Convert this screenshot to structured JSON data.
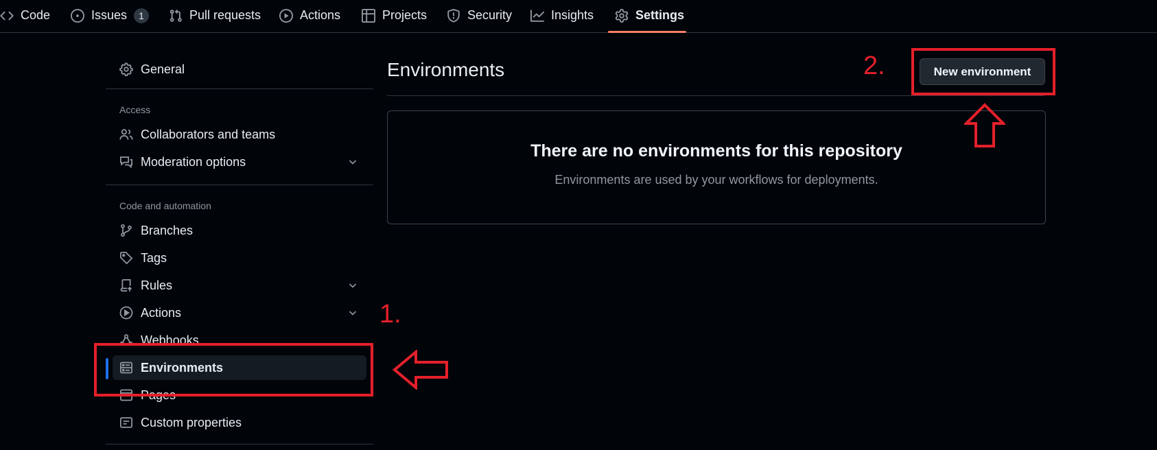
{
  "topnav": {
    "tabs": [
      {
        "label": "Code",
        "icon": "code-icon"
      },
      {
        "label": "Issues",
        "icon": "issue-opened-icon",
        "count": "1"
      },
      {
        "label": "Pull requests",
        "icon": "git-pull-request-icon"
      },
      {
        "label": "Actions",
        "icon": "play-icon"
      },
      {
        "label": "Projects",
        "icon": "table-icon"
      },
      {
        "label": "Security",
        "icon": "shield-icon"
      },
      {
        "label": "Insights",
        "icon": "graph-icon"
      },
      {
        "label": "Settings",
        "icon": "gear-icon",
        "active": true
      }
    ]
  },
  "sidebar": {
    "general": "General",
    "sections": [
      {
        "label": "Access",
        "items": [
          "Collaborators and teams",
          "Moderation options"
        ]
      },
      {
        "label": "Code and automation",
        "items": [
          "Branches",
          "Tags",
          "Rules",
          "Actions",
          "Webhooks",
          "Environments",
          "Pages",
          "Custom properties"
        ]
      }
    ],
    "active_item": "Environments"
  },
  "main": {
    "title": "Environments",
    "new_button": "New environment",
    "blankslate": {
      "heading": "There are no environments for this repository",
      "description": "Environments are used by your workflows for deployments."
    }
  },
  "annotations": {
    "step1": "1.",
    "step2": "2.",
    "color": "#e5202a"
  },
  "colors": {
    "background": "#010409",
    "accent_underline": "#f78166",
    "active_bar": "#1f6feb",
    "border": "#30363d",
    "muted_text": "#9198a1"
  }
}
